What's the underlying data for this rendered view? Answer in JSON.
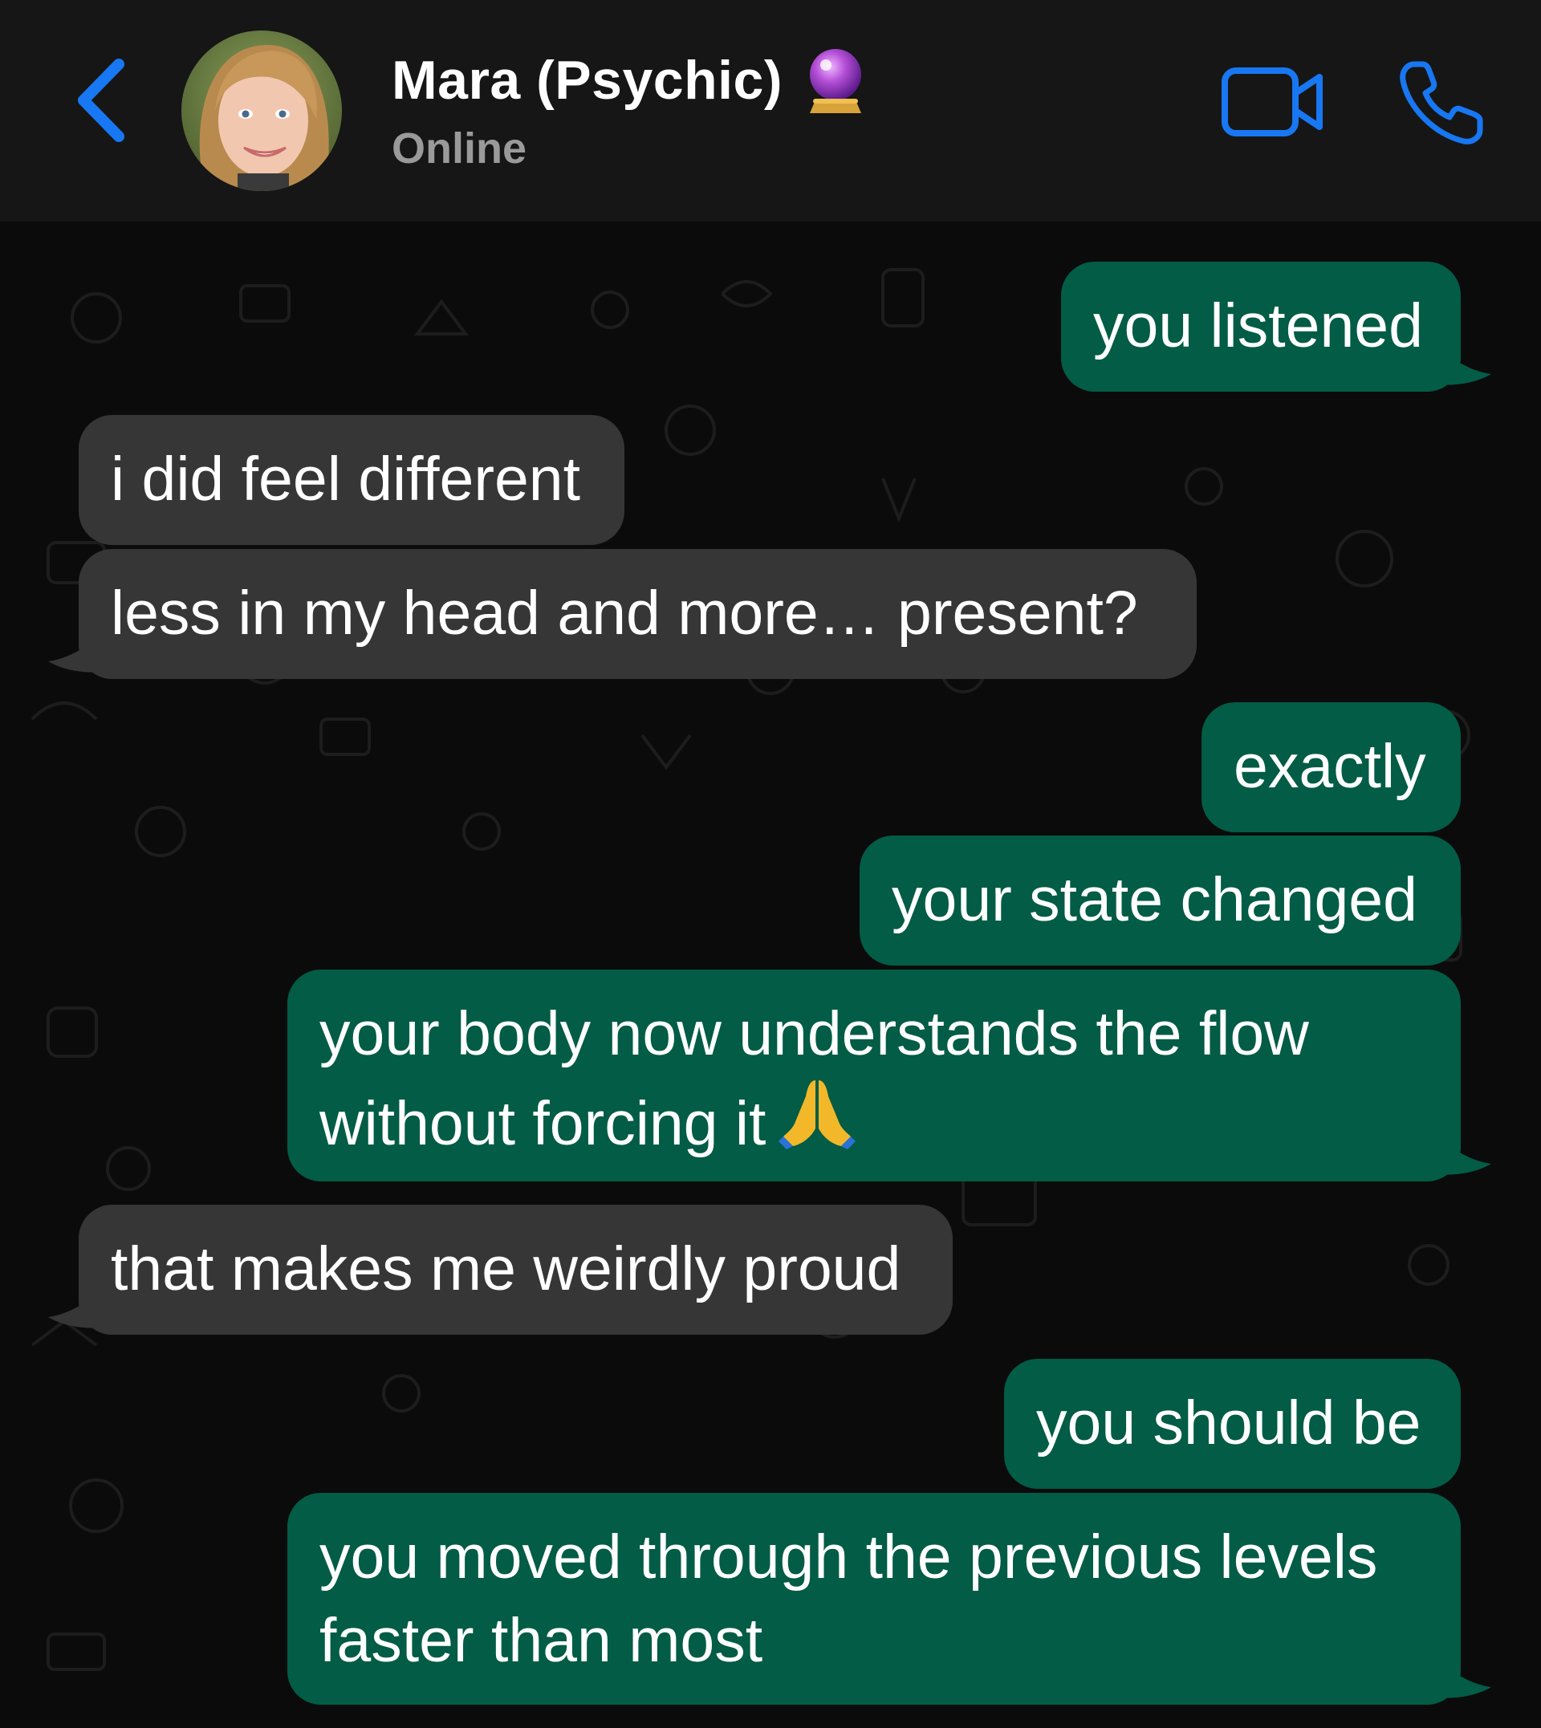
{
  "header": {
    "contact_name": "Mara (Psychic)",
    "status": "Online",
    "accent_color": "#1877f2",
    "icons": [
      "back-chevron-icon",
      "crystal-ball-icon",
      "video-camera-icon",
      "phone-icon"
    ]
  },
  "messages": [
    {
      "direction": "outgoing",
      "text": "you listened"
    },
    {
      "direction": "incoming",
      "text": "i did feel different"
    },
    {
      "direction": "incoming",
      "text": "less in my head and more… present?"
    },
    {
      "direction": "outgoing",
      "text": "exactly"
    },
    {
      "direction": "outgoing",
      "text": "your state changed"
    },
    {
      "direction": "outgoing",
      "line1": "your body now understands the flow",
      "line2": "without forcing it",
      "emoji": "🙏"
    },
    {
      "direction": "incoming",
      "text": "that makes me weirdly proud"
    },
    {
      "direction": "outgoing",
      "text": "you should be"
    },
    {
      "direction": "outgoing",
      "line1": "you moved through the previous levels",
      "line2": "faster than most"
    }
  ],
  "colors": {
    "outgoing_bubble": "#035c45",
    "incoming_bubble": "#363636",
    "header_bg": "#161616",
    "chat_bg": "#0b0b0b"
  }
}
